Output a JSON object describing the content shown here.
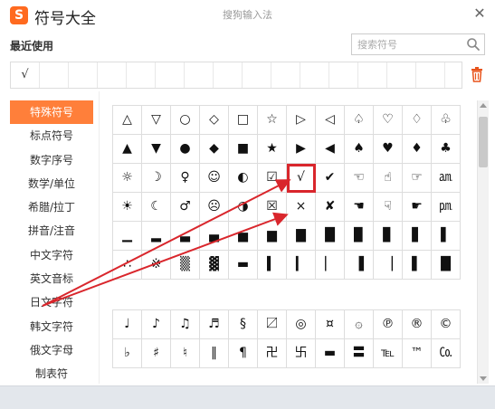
{
  "window": {
    "logo_letter": "S",
    "title": "符号大全",
    "hint": "搜狗输入法",
    "close_glyph": "✕"
  },
  "recent": {
    "label": "最近使用",
    "items": [
      "√"
    ]
  },
  "search": {
    "placeholder": "搜索符号"
  },
  "sidebar": {
    "items": [
      {
        "label": "特殊符号",
        "active": true
      },
      {
        "label": "标点符号"
      },
      {
        "label": "数字序号"
      },
      {
        "label": "数学/单位"
      },
      {
        "label": "希腊/拉丁"
      },
      {
        "label": "拼音/注音"
      },
      {
        "label": "中文字符"
      },
      {
        "label": "英文音标"
      },
      {
        "label": "日文字符"
      },
      {
        "label": "韩文字符"
      },
      {
        "label": "俄文字母"
      },
      {
        "label": "制表符"
      }
    ]
  },
  "symbols": {
    "group1": [
      "△",
      "▽",
      "○",
      "◇",
      "□",
      "☆",
      "▷",
      "◁",
      "♤",
      "♡",
      "♢",
      "♧",
      "▲",
      "▼",
      "●",
      "◆",
      "■",
      "★",
      "▶",
      "◀",
      "♠",
      "♥",
      "♦",
      "♣",
      "☼",
      "☽",
      "♀",
      "☺",
      "◐",
      "☑",
      "√",
      "✔",
      "☜",
      "☝",
      "☞",
      "㏂",
      "☀",
      "☾",
      "♂",
      "☹",
      "◑",
      "☒",
      "×",
      "✘",
      "☚",
      "☟",
      "☛",
      "㏘",
      "▁",
      "▂",
      "▃",
      "▄",
      "▅",
      "▆",
      "▇",
      "█",
      "▉",
      "▊",
      "▋",
      "▌",
      "∴",
      "※",
      "▒",
      "▓",
      "▬",
      "▍",
      "▎",
      "▏",
      "▐",
      "▕",
      "▌",
      "█"
    ],
    "group2": [
      "♩",
      "♪",
      "♫",
      "♬",
      "§",
      "〼",
      "◎",
      "¤",
      "۞",
      "℗",
      "®",
      "©",
      "♭",
      "♯",
      "♮",
      "‖",
      "¶",
      "卍",
      "卐",
      "▬",
      "〓",
      "℡",
      "™",
      "㏇"
    ]
  },
  "selected_symbol": "√",
  "colors": {
    "accent": "#ff7f3a",
    "highlight": "#d9262c",
    "logo": "#ff6a1f"
  }
}
